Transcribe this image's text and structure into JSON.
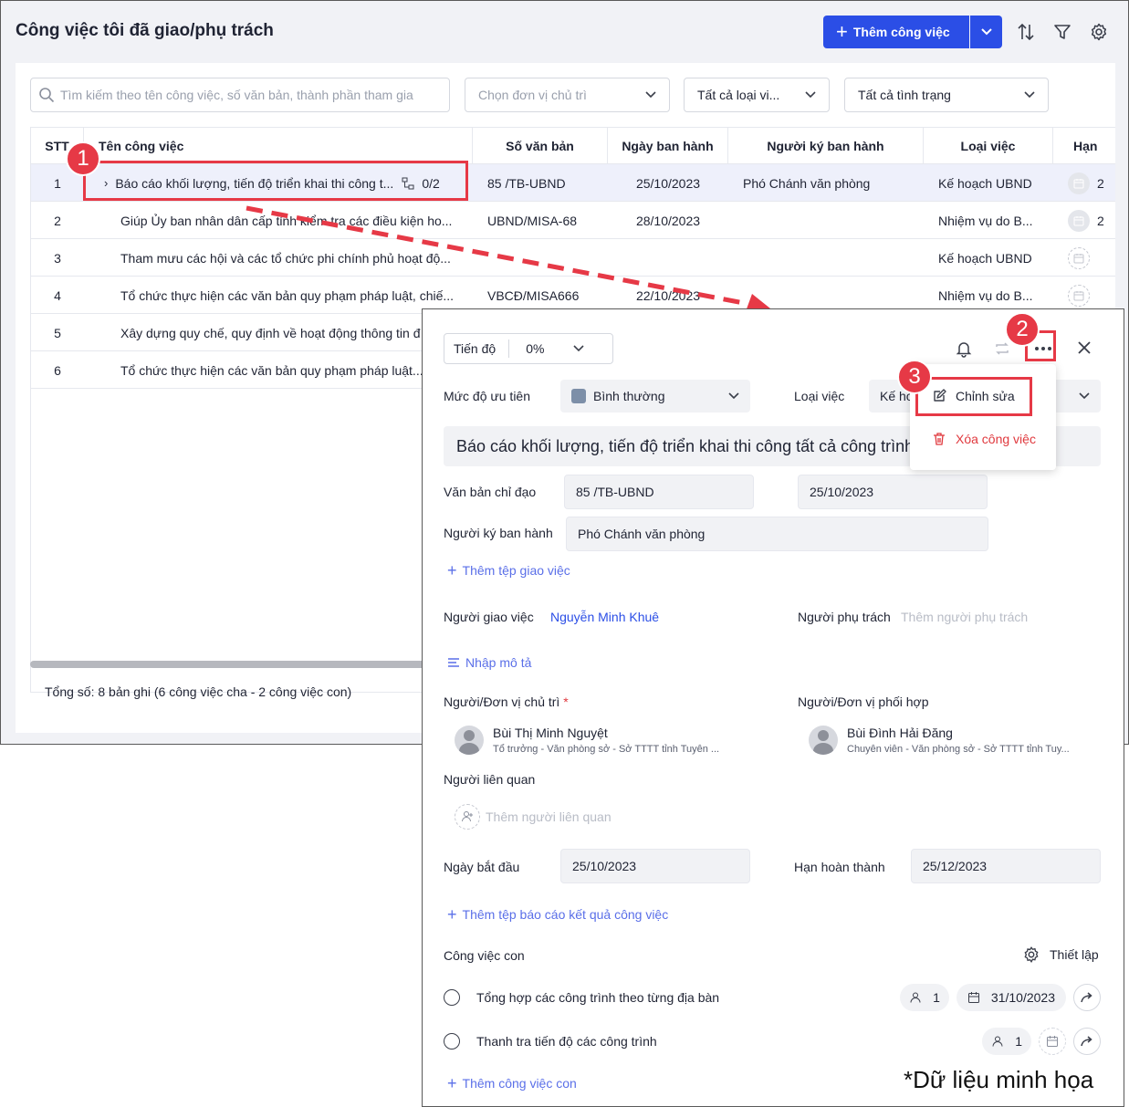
{
  "list": {
    "title": "Công việc tôi đã giao/phụ trách",
    "add_button": "Thêm công việc",
    "search_placeholder": "Tìm kiếm theo tên công việc, số văn bản, thành phần tham gia",
    "filters": {
      "unit": "Chọn đơn vị chủ trì",
      "type": "Tất cả loại vi...",
      "status": "Tất cả tình trạng"
    },
    "columns": [
      "STT",
      "Tên công việc",
      "Số văn bản",
      "Ngày ban hành",
      "Người ký ban hành",
      "Loại việc",
      "Hạn"
    ],
    "rows": [
      {
        "stt": "1",
        "name": "Báo cáo khối lượng, tiến độ triển khai thi công t...",
        "subcount": "0/2",
        "doc": "85 /TB-UBND",
        "date": "25/10/2023",
        "signer": "Phó Chánh văn phòng",
        "type": "Kế hoạch UBND",
        "due": "2"
      },
      {
        "stt": "2",
        "name": "Giúp Ủy ban nhân dân cấp tỉnh kiểm tra các điều kiện ho...",
        "subcount": "",
        "doc": "UBND/MISA-68",
        "date": "28/10/2023",
        "signer": "",
        "type": "Nhiệm vụ do B...",
        "due": "2"
      },
      {
        "stt": "3",
        "name": "Tham mưu các hội và các tổ chức phi chính phủ hoạt độ...",
        "subcount": "",
        "doc": "",
        "date": "",
        "signer": "",
        "type": "Kế hoạch UBND",
        "due": ""
      },
      {
        "stt": "4",
        "name": "Tổ chức thực hiện các văn bản quy phạm pháp luật, chiế...",
        "subcount": "",
        "doc": "VBCĐ/MISA666",
        "date": "22/10/2023",
        "signer": "",
        "type": "Nhiệm vụ do B...",
        "due": ""
      },
      {
        "stt": "5",
        "name": "Xây dựng quy chế, quy định về hoạt động thông tin đ",
        "subcount": "",
        "doc": "",
        "date": "",
        "signer": "",
        "type": "",
        "due": ""
      },
      {
        "stt": "6",
        "name": "Tổ chức thực hiện các văn bản quy phạm pháp luật...",
        "subcount": "",
        "doc": "",
        "date": "",
        "signer": "",
        "type": "",
        "due": ""
      }
    ],
    "footer": "Tổng số: 8 bản ghi (6 công việc cha - 2 công việc con)"
  },
  "markers": [
    "1",
    "2",
    "3"
  ],
  "detail": {
    "progress_label": "Tiến độ",
    "progress_value": "0%",
    "priority_label": "Mức độ ưu tiên",
    "priority_value": "Bình thường",
    "priority_color": "#7d8fa8",
    "type_label": "Loại việc",
    "type_value": "Kế hoạ",
    "title": "Báo cáo khối lượng, tiến độ triển khai thi công tất cả công trình",
    "doc_label": "Văn bản chỉ đạo",
    "doc_number": "85 /TB-UBND",
    "doc_date": "25/10/2023",
    "signer_label": "Người ký ban hành",
    "signer_value": "Phó Chánh văn phòng",
    "add_attachment": "Thêm tệp giao việc",
    "assigner_label": "Người giao việc",
    "assigner_value": "Nguyễn Minh Khuê",
    "owner_label": "Người phụ trách",
    "owner_placeholder": "Thêm người phụ trách",
    "description_link": "Nhập mô tả",
    "lead_label": "Người/Đơn vị chủ trì",
    "lead_required": "*",
    "lead_name": "Bùi Thị Minh Nguyệt",
    "lead_sub": "Tổ trưởng - Văn phòng sở - Sở TTTT tỉnh Tuyên ...",
    "coop_label": "Người/Đơn vị phối hợp",
    "coop_name": "Bùi Đình Hải Đăng",
    "coop_sub": "Chuyên viên - Văn phòng sở - Sở TTTT tỉnh Tuy...",
    "related_label": "Người liên quan",
    "related_placeholder": "Thêm người liên quan",
    "start_label": "Ngày bắt đầu",
    "start_value": "25/10/2023",
    "due_label": "Hạn hoàn thành",
    "due_value": "25/12/2023",
    "add_report": "Thêm tệp báo cáo kết quả công việc",
    "subtasks_label": "Công việc con",
    "settings_label": "Thiết lập",
    "subtasks": [
      {
        "name": "Tổng hợp các công trình theo từng địa bàn",
        "count": "1",
        "date": "31/10/2023"
      },
      {
        "name": "Thanh tra tiến độ các công trình",
        "count": "1",
        "date": ""
      }
    ],
    "add_subtask": "Thêm công việc con"
  },
  "menu": {
    "edit": "Chỉnh sửa",
    "delete": "Xóa công việc"
  },
  "note": "*Dữ liệu minh họa",
  "colors": {
    "accent": "#2b4ee6",
    "marker": "#e63946",
    "danger": "#e0393e"
  }
}
